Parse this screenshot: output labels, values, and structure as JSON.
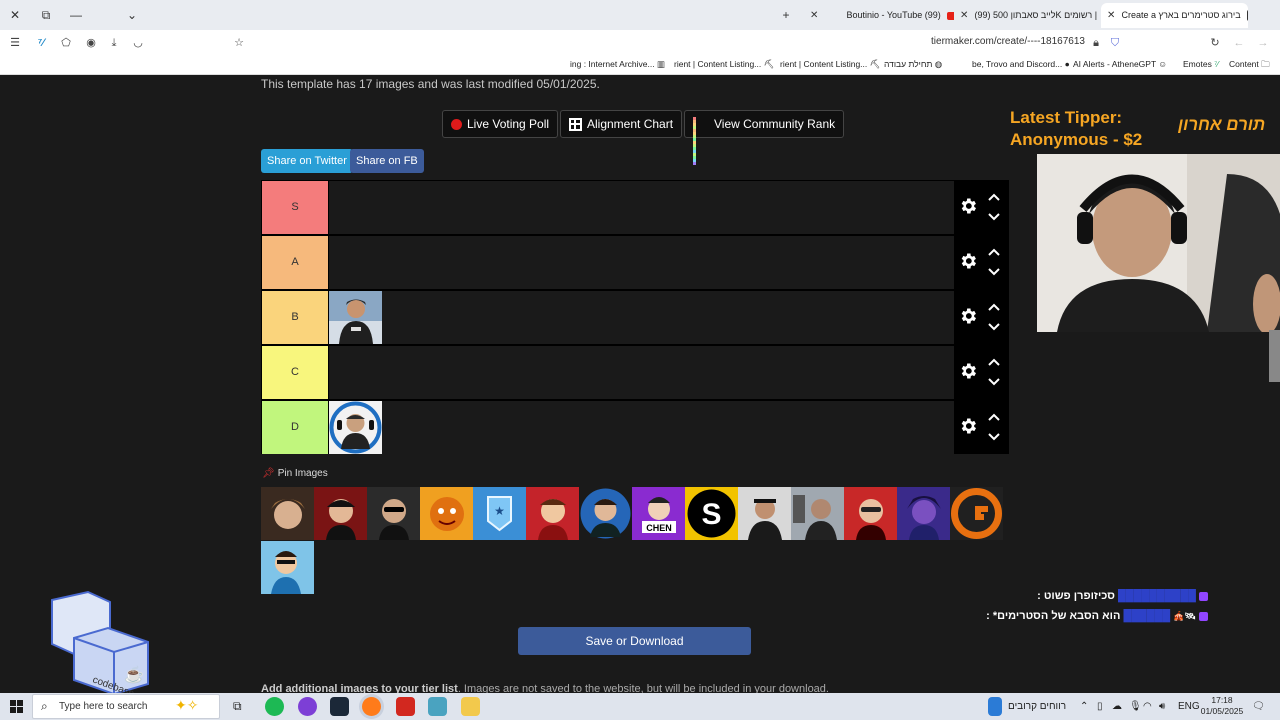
{
  "browser": {
    "tabs": [
      {
        "title": "Create a בירוג סטרימרים בארץ",
        "active": true
      },
      {
        "title": "(99) לייב סאבתון 500K רשומים |",
        "active": false
      },
      {
        "title": "Boutinio - YouTube (99)",
        "active": false
      }
    ],
    "url": "tiermaker.com/create/----18167613",
    "bookmarks": [
      "Content",
      "Emotes",
      "AI Alerts - AtheneGPT",
      "be, Trovo and Discord...",
      "תחילת עבודה",
      "rient | Content Listing...",
      "rient | Content Listing...",
      "ing : Internet Archive..."
    ]
  },
  "page": {
    "template_info": "This template has 17 images and was last modified 05/01/2025.",
    "buttons": {
      "live_poll": "Live Voting Poll",
      "alignment_chart": "Alignment Chart",
      "community_rank": "View Community Rank",
      "share_twitter": "Share on Twitter",
      "share_fb": "Share on FB",
      "save": "Save or Download"
    },
    "tiers": [
      {
        "label": "S",
        "color": "#f47c7c"
      },
      {
        "label": "A",
        "color": "#f6b97c"
      },
      {
        "label": "B",
        "color": "#fad47c"
      },
      {
        "label": "C",
        "color": "#f8f67d"
      },
      {
        "label": "D",
        "color": "#c1f67d"
      }
    ],
    "pin_images": "Pin Images",
    "additional_bold": "Add additional images to your tier list",
    "additional_rest": ". Images are not saved to the website, but will be included in your download."
  },
  "overlay": {
    "tipper_line1": "Latest Tipper:",
    "tipper_line2": "Anonymous - $2",
    "tipper_hebrew": "תורם אחרון",
    "chat": [
      {
        "user": "██████████",
        "message": ": סכיזופרן פשוט"
      },
      {
        "user": "██████",
        "message": ": *הוא הסבא של הסטרימים"
      }
    ],
    "codebase_label": "codebase"
  },
  "taskbar": {
    "search_placeholder": "Type here to search",
    "weather": "רווחים קרובים",
    "language": "ENG",
    "time": "17:18",
    "date": "01/05/2025"
  }
}
